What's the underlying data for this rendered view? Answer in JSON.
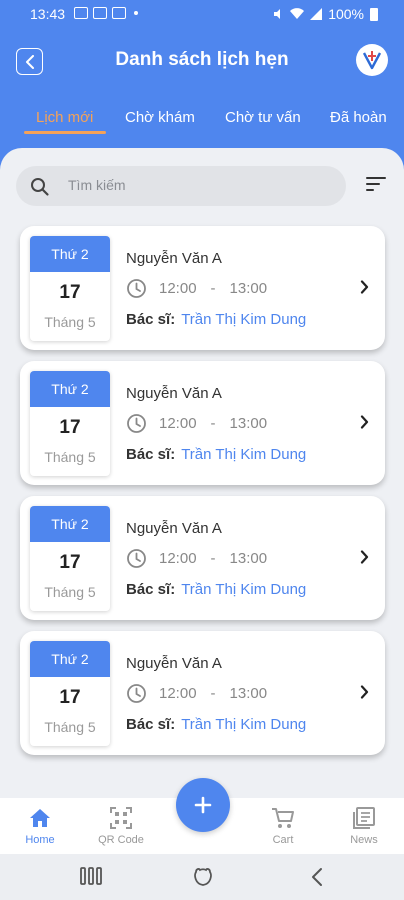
{
  "statusbar": {
    "time": "13:43",
    "battery": "100%"
  },
  "header": {
    "title": "Danh sách lịch hẹn"
  },
  "tabs": [
    {
      "label": "Lịch mới",
      "active": true
    },
    {
      "label": "Chờ khám",
      "active": false
    },
    {
      "label": "Chờ tư vấn",
      "active": false
    },
    {
      "label": "Đã hoàn",
      "active": false
    }
  ],
  "search": {
    "placeholder": "Tìm kiếm"
  },
  "appointments": [
    {
      "day_name": "Thứ 2",
      "day": "17",
      "month": "Tháng 5",
      "patient": "Nguyễn Văn A",
      "start": "12:00",
      "sep": "-",
      "end": "13:00",
      "doctor_label": "Bác sĩ:",
      "doctor": "Trần Thị Kim Dung"
    },
    {
      "day_name": "Thứ 2",
      "day": "17",
      "month": "Tháng 5",
      "patient": "Nguyễn Văn A",
      "start": "12:00",
      "sep": "-",
      "end": "13:00",
      "doctor_label": "Bác sĩ:",
      "doctor": "Trần Thị Kim Dung"
    },
    {
      "day_name": "Thứ 2",
      "day": "17",
      "month": "Tháng 5",
      "patient": "Nguyễn Văn A",
      "start": "12:00",
      "sep": "-",
      "end": "13:00",
      "doctor_label": "Bác sĩ:",
      "doctor": "Trần Thị Kim Dung"
    },
    {
      "day_name": "Thứ 2",
      "day": "17",
      "month": "Tháng 5",
      "patient": "Nguyễn Văn A",
      "start": "12:00",
      "sep": "-",
      "end": "13:00",
      "doctor_label": "Bác sĩ:",
      "doctor": "Trần Thị Kim Dung"
    }
  ],
  "bottom_nav": [
    {
      "label": "Home",
      "icon": "home-icon",
      "active": true
    },
    {
      "label": "QR Code",
      "icon": "qr-code-icon",
      "active": false
    },
    {
      "label": "Cart",
      "icon": "cart-icon",
      "active": false
    },
    {
      "label": "News",
      "icon": "news-icon",
      "active": false
    }
  ],
  "fab": {
    "icon": "plus-icon"
  },
  "colors": {
    "primary": "#4f86ee",
    "accent": "#f4a259",
    "background": "#eef0f4"
  }
}
